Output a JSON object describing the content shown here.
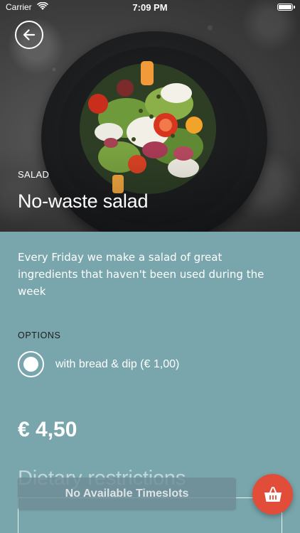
{
  "status_bar": {
    "carrier": "Carrier",
    "time": "7:09 PM"
  },
  "product": {
    "category": "SALAD",
    "title": "No-waste salad",
    "description": "Every Friday we make a salad of great ingredients that haven't been used during the week",
    "price": "€ 4,50"
  },
  "options": {
    "heading": "OPTIONS",
    "items": [
      {
        "label": "with bread & dip (€ 1,00)",
        "selected": true
      }
    ]
  },
  "dietary": {
    "heading": "Dietary restrictions"
  },
  "banner": {
    "text": "No Available Timeslots"
  },
  "colors": {
    "background": "#79a6ac",
    "accent": "#e24d3a",
    "text": "#ffffff"
  },
  "icons": {
    "back": "arrow-left-icon",
    "basket": "basket-icon",
    "wifi": "wifi-icon",
    "battery": "battery-icon"
  }
}
